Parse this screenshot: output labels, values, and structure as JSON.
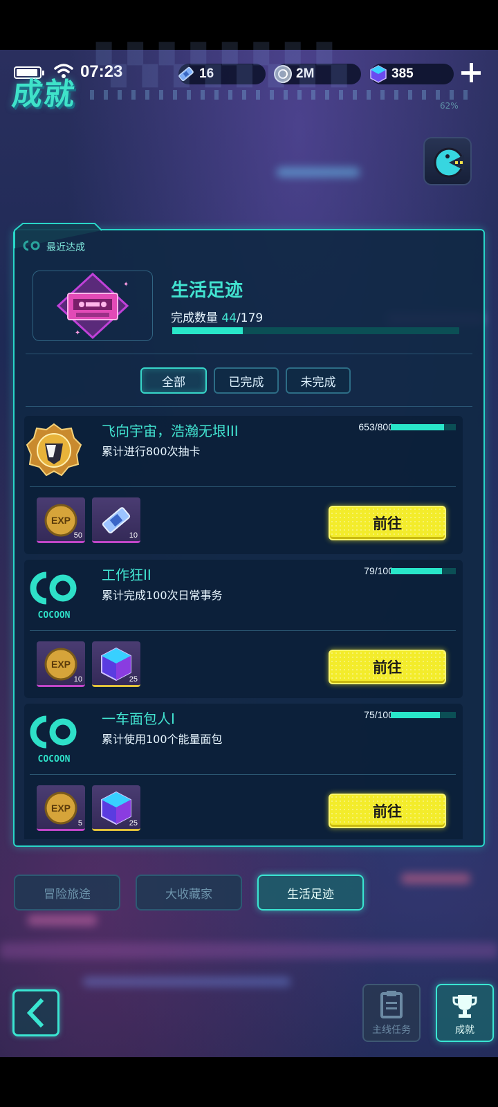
{
  "status_bar": {
    "time": "07:23"
  },
  "resources": {
    "tickets": "16",
    "coins": "2M",
    "gems": "385"
  },
  "page": {
    "title": "成就",
    "progress_hint": "62%"
  },
  "panel": {
    "tab_label": "最近达成",
    "featured": {
      "name": "生活足迹",
      "count_label": "完成数量",
      "completed": "44",
      "total": "/179",
      "progress": 0.246
    }
  },
  "filters": [
    {
      "label": "全部",
      "active": true
    },
    {
      "label": "已完成",
      "active": false
    },
    {
      "label": "未完成",
      "active": false
    }
  ],
  "achievements": [
    {
      "name": "飞向宇宙，浩瀚无垠III",
      "desc": "累计进行800次抽卡",
      "progress_text": "653/800",
      "progress": 0.816,
      "icon": "gold-medal-icon",
      "rewards": [
        {
          "icon": "exp-coin-icon",
          "qty": "50",
          "rarity": "purple"
        },
        {
          "icon": "ticket-icon",
          "qty": "10",
          "rarity": "purple"
        }
      ],
      "button": "前往"
    },
    {
      "name": "工作狂II",
      "desc": "累计完成100次日常事务",
      "progress_text": "79/100",
      "progress": 0.79,
      "icon": "cocoon-logo-icon",
      "logo_text": "COCOON",
      "rewards": [
        {
          "icon": "exp-coin-icon",
          "qty": "10",
          "rarity": "purple"
        },
        {
          "icon": "gem-cube-icon",
          "qty": "25",
          "rarity": "gold"
        }
      ],
      "button": "前往"
    },
    {
      "name": "一车面包人I",
      "desc": "累计使用100个能量面包",
      "progress_text": "75/100",
      "progress": 0.75,
      "icon": "cocoon-logo-icon",
      "logo_text": "COCOON",
      "rewards": [
        {
          "icon": "exp-coin-icon",
          "qty": "5",
          "rarity": "purple"
        },
        {
          "icon": "gem-cube-icon",
          "qty": "25",
          "rarity": "gold"
        }
      ],
      "button": "前往"
    }
  ],
  "categories": [
    {
      "label": "冒险旅途",
      "active": false
    },
    {
      "label": "大收藏家",
      "active": false
    },
    {
      "label": "生活足迹",
      "active": true
    }
  ],
  "bottom_nav": {
    "main_quest": "主线任务",
    "achievements": "成就"
  },
  "colors": {
    "accent": "#3ae6d2",
    "button_yellow": "#f3ec2b",
    "panel_bg": "#10283e"
  }
}
